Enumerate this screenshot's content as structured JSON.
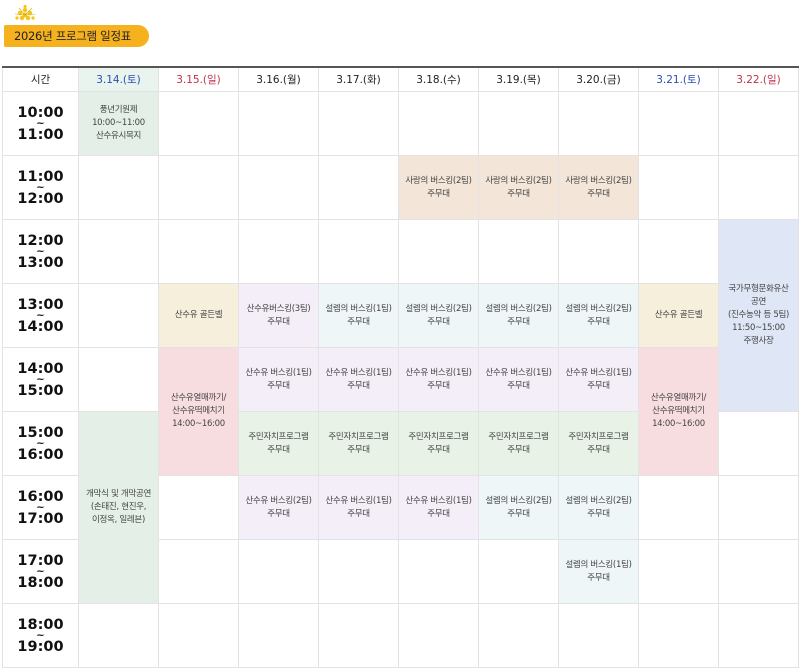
{
  "title": "2026년 프로그램 일정표",
  "colors": {
    "badge": "#f5b21e",
    "saturday": "#2b4fb0",
    "sunday": "#c0304a"
  },
  "columns": {
    "time": "시간",
    "d1": "3.14.(토)",
    "d2": "3.15.(일)",
    "d3": "3.16.(월)",
    "d4": "3.17.(화)",
    "d5": "3.18.(수)",
    "d6": "3.19.(목)",
    "d7": "3.20.(금)",
    "d8": "3.21.(토)",
    "d9": "3.22.(일)"
  },
  "times": [
    {
      "start": "10:00",
      "end": "11:00"
    },
    {
      "start": "11:00",
      "end": "12:00"
    },
    {
      "start": "12:00",
      "end": "13:00"
    },
    {
      "start": "13:00",
      "end": "14:00"
    },
    {
      "start": "14:00",
      "end": "15:00"
    },
    {
      "start": "15:00",
      "end": "16:00"
    },
    {
      "start": "16:00",
      "end": "17:00"
    },
    {
      "start": "17:00",
      "end": "18:00"
    },
    {
      "start": "18:00",
      "end": "19:00"
    }
  ],
  "tilde": "~",
  "events": {
    "opening_ritual": {
      "l1": "풍년기원제",
      "l2": "10:00~11:00",
      "l3": "산수유시목지"
    },
    "love_busking": {
      "l1": "사랑의 버스킹(2팀)",
      "l2": "주무대"
    },
    "heritage": {
      "l1": "국가무형문화유산",
      "l2": "공연",
      "l3": "(진수농악 등 5팀)",
      "l4": "11:50~15:00",
      "l5": "주행사장"
    },
    "golden_bell": {
      "l1": "산수유 골든벨"
    },
    "busk3": {
      "l1": "산수유버스킹(3팀)",
      "l2": "주무대"
    },
    "seollem1": {
      "l1": "설렘의 버스킹(1팀)",
      "l2": "주무대"
    },
    "seollem2": {
      "l1": "설렘의 버스킹(2팀)",
      "l2": "주무대"
    },
    "busk1": {
      "l1": "산수유 버스킹(1팀)",
      "l2": "주무대"
    },
    "busk2": {
      "l1": "산수유 버스킹(2팀)",
      "l2": "주무대"
    },
    "fruit": {
      "l1": "산수유열매까기/",
      "l2": "산수유떡메치기",
      "l3": "14:00~16:00"
    },
    "resident": {
      "l1": "주민자치프로그램",
      "l2": "주무대"
    },
    "opening": {
      "l1": "개막식 및 개막공연",
      "l2": "(손태진, 현진우,",
      "l3": "이정옥, 일레븐)"
    }
  }
}
